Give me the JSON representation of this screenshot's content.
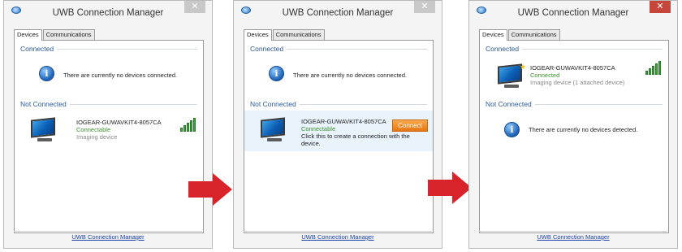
{
  "window": {
    "title": "UWB Connection Manager",
    "close_glyph": "✕",
    "tabs": [
      "Devices",
      "Communications"
    ],
    "footer_link": "UWB Connection Manager"
  },
  "groups": {
    "connected": "Connected",
    "not_connected": "Not Connected"
  },
  "messages": {
    "no_devices_connected": "There are currently no devices connected.",
    "no_devices_detected": "There are currently no devices detected."
  },
  "device": {
    "name": "IOGEAR-GUWAVKIT4-8057CA",
    "status_connectable": "Connectable",
    "status_connected": "Connected",
    "type": "Imaging device",
    "type_attached": "Imaging device (1 attached device)",
    "hint": "Click this to create a connection with the device.",
    "connect_label": "Connect",
    "signal_level": 1.0
  },
  "colors": {
    "group_label": "#2b5a9a",
    "status_green": "#3c8f2c",
    "arrow_red": "#d9232a",
    "connect_orange": "#e8750e",
    "close_red": "#c7463a"
  },
  "icons": [
    "app-icon",
    "close-icon",
    "info-icon",
    "monitor-icon",
    "signal-strength-icon",
    "star-icon",
    "arrow-right-icon"
  ]
}
